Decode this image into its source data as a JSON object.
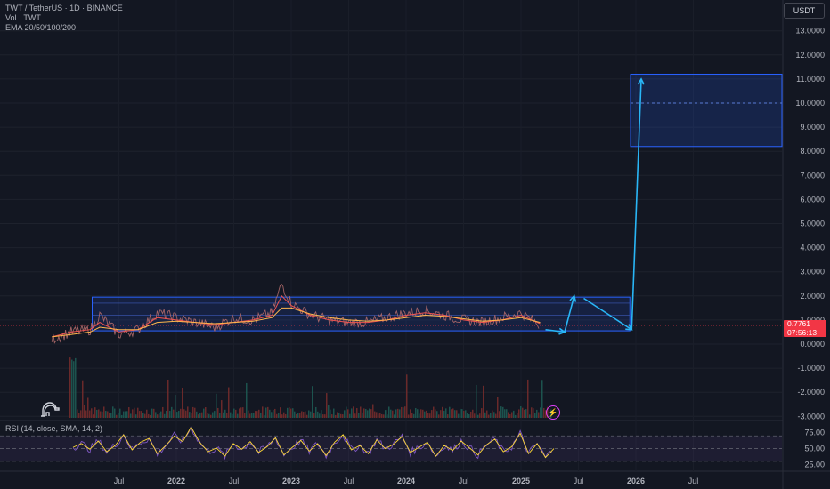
{
  "legend": {
    "symbol_line": "TWT / TetherUS · 1D · BINANCE",
    "volume_line": "Vol · TWT",
    "ema_line": "EMA 20/50/100/200"
  },
  "unit_button": "USDT",
  "rsi_label": "RSI (14, close, SMA, 14, 2)",
  "last_price": "0.7761",
  "countdown": "07:56:13",
  "colors": {
    "background": "#131722",
    "candle_up": "#26a69a",
    "candle_down": "#ef5350",
    "channel": "#2962ff",
    "arrow": "#29b6f6",
    "rsi_line": "#7e57c2",
    "rsi_sma": "#fdd835",
    "price_tag": "#f23645"
  },
  "chart_data": [
    {
      "type": "line",
      "name": "price",
      "x_tick_labels": [
        "Jul",
        "2022",
        "Jul",
        "2023",
        "Jul",
        "2024",
        "Jul",
        "2025",
        "Jul",
        "2026",
        "Jul"
      ],
      "y_tick_labels": [
        "13.0000",
        "12.0000",
        "11.0000",
        "10.0000",
        "9.0000",
        "8.0000",
        "7.0000",
        "6.0000",
        "5.0000",
        "4.0000",
        "3.0000",
        "2.0000",
        "1.0000",
        "0.0000",
        "-1.0000",
        "-2.0000",
        "-3.0000"
      ],
      "ylim": [
        -3.2,
        13.7
      ],
      "x": [
        "2020-12",
        "2021-02",
        "2021-04",
        "2021-05",
        "2021-07",
        "2021-09",
        "2021-11",
        "2022-01",
        "2022-03",
        "2022-05",
        "2022-07",
        "2022-09",
        "2022-11",
        "2022-12",
        "2023-01",
        "2023-03",
        "2023-05",
        "2023-07",
        "2023-09",
        "2023-11",
        "2024-01",
        "2024-03",
        "2024-05",
        "2024-07",
        "2024-09",
        "2024-11",
        "2025-01",
        "2025-03"
      ],
      "values": [
        0.2,
        0.5,
        0.6,
        1.2,
        0.4,
        0.6,
        1.3,
        1.1,
        0.9,
        0.7,
        1.1,
        1.0,
        1.3,
        2.5,
        1.7,
        1.2,
        1.0,
        0.9,
        0.9,
        1.1,
        1.3,
        1.4,
        1.2,
        1.0,
        0.9,
        1.1,
        1.3,
        0.78
      ],
      "ema_series": [
        {
          "values": [
            0.3,
            0.5,
            0.6,
            0.9,
            0.5,
            0.6,
            1.1,
            1.0,
            0.9,
            0.8,
            0.9,
            1.0,
            1.2,
            2.0,
            1.6,
            1.2,
            1.0,
            0.9,
            0.9,
            1.0,
            1.2,
            1.3,
            1.2,
            1.0,
            0.9,
            1.0,
            1.2,
            0.85
          ],
          "color": "#ef5350"
        },
        {
          "values": [
            0.3,
            0.4,
            0.5,
            0.7,
            0.6,
            0.6,
            0.9,
            0.95,
            0.9,
            0.85,
            0.9,
            0.95,
            1.1,
            1.5,
            1.5,
            1.25,
            1.1,
            1.0,
            0.95,
            1.0,
            1.1,
            1.2,
            1.15,
            1.05,
            0.95,
            1.0,
            1.1,
            0.9
          ],
          "color": "#ffb74d"
        }
      ],
      "channel": {
        "x_start": "2021-07",
        "x_end": "2025-12",
        "lower": 0.55,
        "upper": 1.95
      },
      "projection_arrows": [
        {
          "from": [
            "2025-03",
            0.6
          ],
          "to": [
            "2025-05",
            0.5
          ]
        },
        {
          "from": [
            "2025-05",
            0.5
          ],
          "to": [
            "2025-06",
            2.0
          ]
        },
        {
          "from": [
            "2025-07",
            1.9
          ],
          "to": [
            "2025-12",
            0.6
          ]
        },
        {
          "from": [
            "2025-12",
            0.6
          ],
          "to": [
            "2026-01",
            11.0
          ]
        }
      ],
      "target_zone": {
        "x_start": "2026-01",
        "x_end": "2026-12",
        "lower": 8.2,
        "upper": 11.2
      }
    },
    {
      "type": "line",
      "name": "RSI",
      "y_tick_labels": [
        "75.00",
        "50.00",
        "25.00"
      ],
      "ylim": [
        20,
        90
      ],
      "bands": [
        70,
        30
      ],
      "values": [
        52,
        58,
        49,
        62,
        45,
        55,
        72,
        48,
        60,
        66,
        42,
        55,
        70,
        61,
        84,
        60,
        45,
        51,
        38,
        58,
        49,
        61,
        44,
        53,
        67,
        40,
        52,
        63,
        46,
        58,
        39,
        60,
        72,
        48,
        55,
        42,
        64,
        50,
        57,
        69,
        44,
        52,
        60,
        38,
        55,
        47,
        62,
        51,
        40,
        56,
        65,
        45,
        53,
        74,
        42,
        58,
        36,
        50
      ]
    }
  ]
}
